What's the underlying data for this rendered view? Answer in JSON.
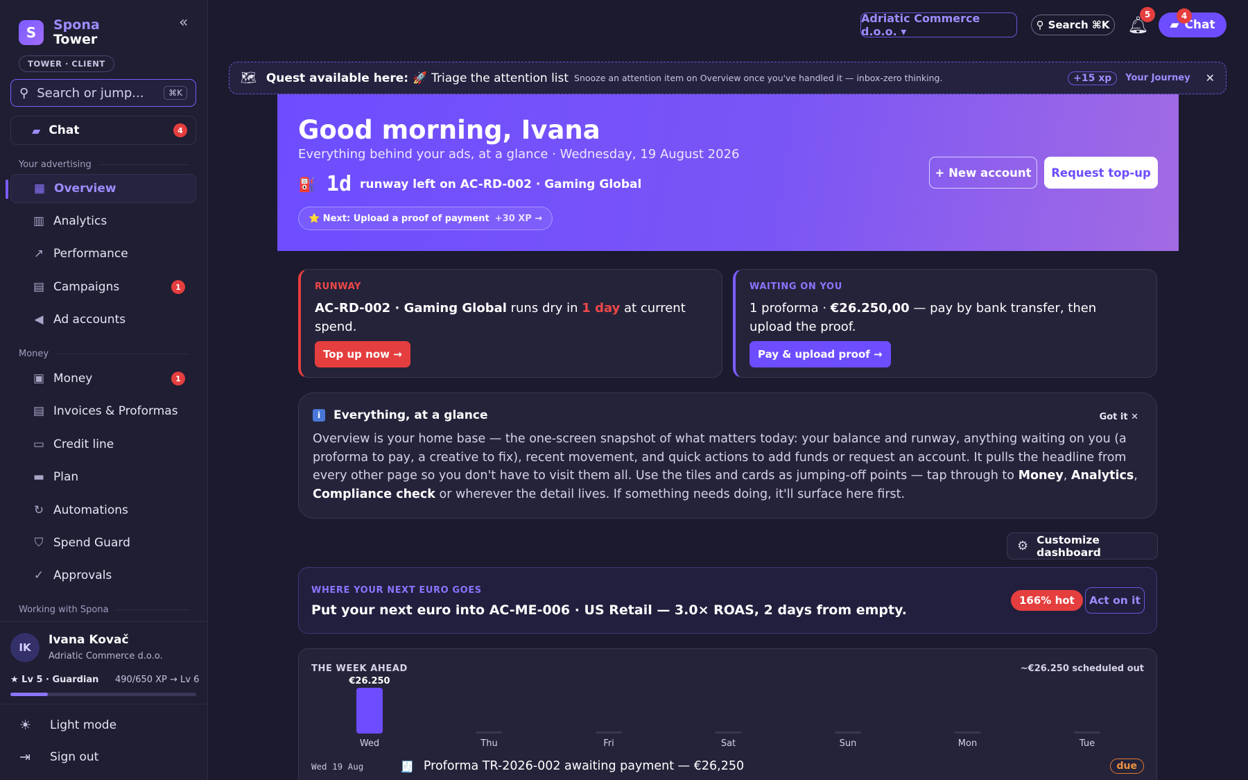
{
  "brand": {
    "name": "Spona",
    "sub": "Tower",
    "role": "TOWER · CLIENT",
    "collapse_icon": "«"
  },
  "sidebar": {
    "search_placeholder": "Search or jump...",
    "search_kbd": "⌘K",
    "chat": {
      "label": "Chat",
      "badge": "4"
    },
    "sections": {
      "advertising": "Your advertising",
      "money": "Money",
      "working": "Working with Spona"
    },
    "items": [
      {
        "label": "Overview",
        "icon": "grid-icon",
        "glyph": "▦",
        "badge": ""
      },
      {
        "label": "Analytics",
        "icon": "bar-chart-icon",
        "glyph": "▥",
        "badge": ""
      },
      {
        "label": "Performance",
        "icon": "trend-icon",
        "glyph": "↗",
        "badge": ""
      },
      {
        "label": "Campaigns",
        "icon": "hierarchy-icon",
        "glyph": "▤",
        "badge": "1"
      },
      {
        "label": "Ad accounts",
        "icon": "megaphone-icon",
        "glyph": "◀",
        "badge": ""
      },
      {
        "label": "Money",
        "icon": "wallet-icon",
        "glyph": "▣",
        "badge": "1"
      },
      {
        "label": "Invoices & Proformas",
        "icon": "receipt-icon",
        "glyph": "▤",
        "badge": ""
      },
      {
        "label": "Credit line",
        "icon": "card-icon",
        "glyph": "▭",
        "badge": ""
      },
      {
        "label": "Plan",
        "icon": "monitor-icon",
        "glyph": "▬",
        "badge": ""
      },
      {
        "label": "Automations",
        "icon": "refresh-icon",
        "glyph": "↻",
        "badge": ""
      },
      {
        "label": "Spend Guard",
        "icon": "shield-icon",
        "glyph": "⛉",
        "badge": ""
      },
      {
        "label": "Approvals",
        "icon": "check-circle-icon",
        "glyph": "✓",
        "badge": ""
      }
    ],
    "user": {
      "initials": "IK",
      "name": "Ivana Kovač",
      "org": "Adriatic Commerce d.o.o.",
      "level": "★ Lv 5 · Guardian",
      "xp": "490/650 XP → Lv 6",
      "xp_progress": 0.2
    },
    "light_mode": "Light mode",
    "sign_out": "Sign out"
  },
  "topbar": {
    "org": "Adriatic Commerce d.o.o. ▾",
    "search": "Search ⌘K",
    "bell_badge": "5",
    "chat": "Chat",
    "chat_badge": "4"
  },
  "quest": {
    "icon": "🗺",
    "lead": "Quest available here: 🚀",
    "title": "Triage the attention list",
    "desc": "Snooze an attention item on Overview once you've handled it — inbox-zero thinking.",
    "xp": "+15 xp",
    "journey": "Your Journey",
    "close": "✕"
  },
  "hero": {
    "greeting": "Good morning, Ivana",
    "sub": "Everything behind your ads, at a glance · Wednesday, 19 August 2026",
    "fuel_icon": "⛽",
    "runway_value": "1d",
    "runway_text": "runway left on AC-RD-002 · Gaming Global",
    "next": "⭐ Next: Upload a proof of payment",
    "next_xp": "+30 XP →",
    "new_account": "+ New account",
    "request_topup": "Request top-up"
  },
  "runway_card": {
    "eyebrow": "RUNWAY",
    "account": "AC-RD-002 · Gaming Global",
    "mid": " runs dry in ",
    "days": "1 day",
    "tail": " at current spend.",
    "button": "Top up now →",
    "accent": "#e53e3e"
  },
  "waiting_card": {
    "eyebrow": "WAITING ON YOU",
    "lead": "1 proforma · ",
    "amount": "€26.250,00",
    "tail": " — pay by bank transfer, then upload the proof.",
    "button": "Pay & upload proof →",
    "accent": "#7a5cff"
  },
  "glance": {
    "icon": "i",
    "title": "Everything, at a glance",
    "got_it": "Got it ✕",
    "p1": "Overview is your home base — the one-screen snapshot of what matters today: your balance and runway, anything waiting on you (a proforma to pay, a creative to fix), recent movement, and quick actions to add funds or request an account. It pulls the headline from every other page so you don't have to visit them all. Use the tiles and cards as jumping-off points — tap through to ",
    "l1": "Money",
    "c1": ", ",
    "l2": "Analytics",
    "c2": ", ",
    "l3": "Compliance check",
    "p2": " or wherever the detail lives. If something needs doing, it'll surface here first."
  },
  "customize": {
    "label": "Customize dashboard",
    "icon": "⚙"
  },
  "euro": {
    "eyebrow": "WHERE YOUR NEXT EURO GOES",
    "headline": "Put your next euro into AC-ME-006 · US Retail — 3.0× ROAS, 2 days from empty.",
    "hot": "166% hot",
    "act": "Act on it"
  },
  "week": {
    "eyebrow": "THE WEEK AHEAD",
    "scheduled": "~€26.250 scheduled out",
    "event": {
      "date": "Wed 19 Aug",
      "icon": "🧾",
      "text": "Proforma TR-2026-002 awaiting payment — €26,250",
      "status": "due"
    }
  },
  "chart_data": {
    "type": "bar",
    "categories": [
      "Wed",
      "Thu",
      "Fri",
      "Sat",
      "Sun",
      "Mon",
      "Tue"
    ],
    "values": [
      26250,
      0,
      0,
      0,
      0,
      0,
      0
    ],
    "value_labels": [
      "€26.250",
      "",
      "",
      "",
      "",
      "",
      ""
    ],
    "title": "",
    "xlabel": "",
    "ylabel": "",
    "ylim": [
      0,
      26250
    ],
    "color": "#6d4dff",
    "empty_color": "#3a3752"
  }
}
